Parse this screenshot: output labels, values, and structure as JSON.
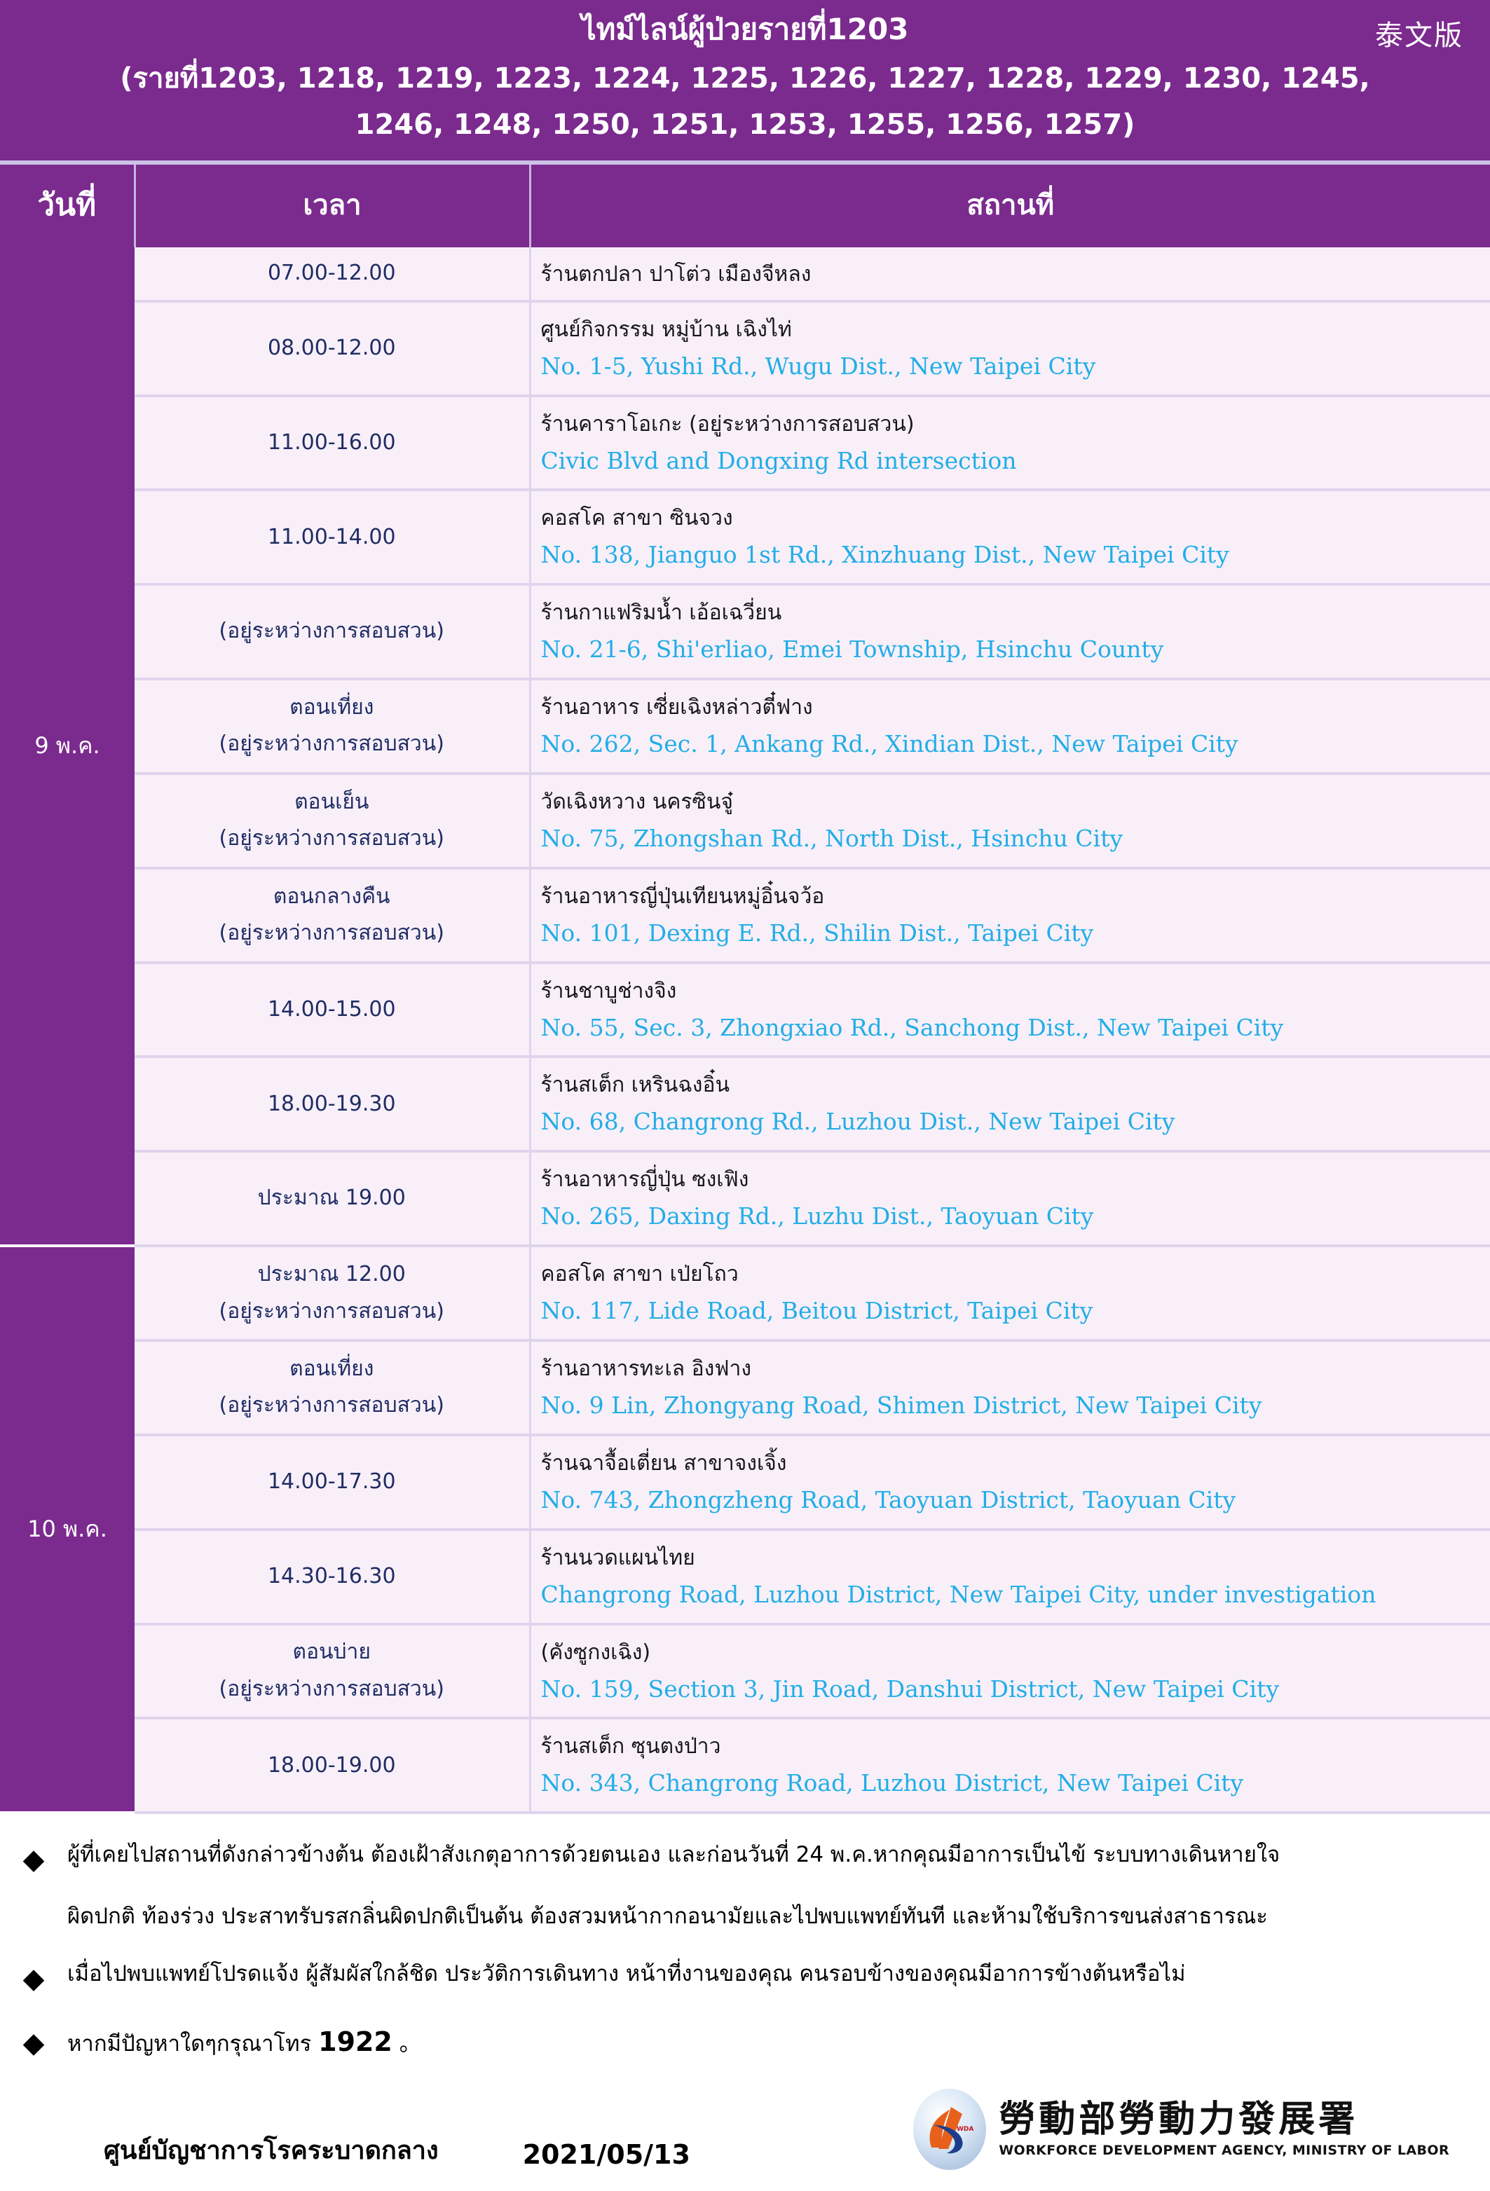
{
  "header": {
    "title": "ไทม์ไลน์ผู้ป่วยรายที่1203",
    "subtitle": "(รายที่1203, 1218, 1219, 1223, 1224, 1225, 1226, 1227, 1228, 1229, 1230, 1245, 1246, 1248, 1250, 1251, 1253, 1255, 1256, 1257)",
    "lang_badge": "泰文版",
    "bg_color": "#7B2A8E"
  },
  "table": {
    "columns": {
      "date": "วันที่",
      "time": "เวลา",
      "place": "สถานที่"
    },
    "groups": [
      {
        "date": "9 พ.ค.",
        "rows": [
          {
            "time": "07.00-12.00",
            "place_th": "ร้านตกปลา ปาโต่ว เมืองจีหลง",
            "place_en": ""
          },
          {
            "time": "08.00-12.00",
            "place_th": "ศูนย์กิจกรรม หมู่บ้าน เฉิงไท่",
            "place_en": "No. 1-5, Yushi Rd., Wugu Dist., New Taipei City"
          },
          {
            "time": "11.00-16.00",
            "place_th": "ร้านคาราโอเกะ (อยู่ระหว่างการสอบสวน)",
            "place_en": "Civic Blvd and Dongxing Rd intersection"
          },
          {
            "time": "11.00-14.00",
            "place_th": "คอสโค สาขา ซินจวง",
            "place_en": "No. 138, Jianguo 1st Rd., Xinzhuang Dist., New Taipei City"
          },
          {
            "time": "(อยู่ระหว่างการสอบสวน)",
            "place_th": "ร้านกาแฟริมน้ำ เอ้อเฉวี่ยน",
            "place_en": "No. 21-6, Shi'erliao, Emei Township, Hsinchu County"
          },
          {
            "time": "ตอนเที่ยง\n(อยู่ระหว่างการสอบสวน)",
            "place_th": "ร้านอาหาร เซี่ยเฉิงหล่าวตี๋ฟาง",
            "place_en": "No. 262, Sec. 1, Ankang Rd., Xindian Dist., New Taipei City"
          },
          {
            "time": "ตอนเย็น\n(อยู่ระหว่างการสอบสวน)",
            "place_th": "วัดเฉิงหวาง นครซินจู๋",
            "place_en": "No. 75, Zhongshan Rd., North Dist., Hsinchu City"
          },
          {
            "time": "ตอนกลางคืน\n(อยู่ระหว่างการสอบสวน)",
            "place_th": "ร้านอาหารญี่ปุ่นเทียนหมู่อิ๋นจว้อ",
            "place_en": "No. 101, Dexing E. Rd., Shilin Dist., Taipei City"
          },
          {
            "time": "14.00-15.00",
            "place_th": "ร้านชาบูช่างจิง",
            "place_en": "No. 55, Sec. 3, Zhongxiao Rd., Sanchong Dist., New Taipei City"
          },
          {
            "time": "18.00-19.30",
            "place_th": "ร้านสเต็ก เหรินฉงอิ๋น",
            "place_en": "No. 68, Changrong Rd., Luzhou Dist., New Taipei City"
          },
          {
            "time": "ประมาณ 19.00",
            "place_th": "ร้านอาหารญี่ปุ่น ซงเฟิง",
            "place_en": "No. 265, Daxing Rd., Luzhu Dist., Taoyuan City"
          }
        ]
      },
      {
        "date": "10 พ.ค.",
        "rows": [
          {
            "time": "ประมาณ 12.00\n(อยู่ระหว่างการสอบสวน)",
            "place_th": "คอสโค สาขา เป่ยโถว",
            "place_en": "No. 117, Lide Road, Beitou District, Taipei City"
          },
          {
            "time": "ตอนเที่ยง\n(อยู่ระหว่างการสอบสวน)",
            "place_th": "ร้านอาหารทะเล อิงฟาง",
            "place_en": "No. 9 Lin, Zhongyang Road, Shimen District, New Taipei City"
          },
          {
            "time": "14.00-17.30",
            "place_th": "ร้านฉาจื้อเตี่ยน สาขาจงเจิ้ง",
            "place_en": "No. 743, Zhongzheng Road, Taoyuan District, Taoyuan City"
          },
          {
            "time": "14.30-16.30",
            "place_th": "ร้านนวดแผนไทย",
            "place_en": "Changrong Road, Luzhou District, New Taipei City, under investigation"
          },
          {
            "time": "ตอนบ่าย\n(อยู่ระหว่างการสอบสวน)",
            "place_th": "(คังซูกงเฉิง)",
            "place_en": "No. 159, Section 3, Jin Road, Danshui District, New Taipei City"
          },
          {
            "time": "18.00-19.00",
            "place_th": "ร้านสเต็ก ซุนตงป่าว",
            "place_en": "No. 343, Changrong Road, Luzhou District, New Taipei City"
          }
        ]
      }
    ]
  },
  "notes": {
    "bullet_glyph": "◆",
    "items": [
      {
        "line1": "ผู้ที่เคยไปสถานที่ดังกล่าวข้างต้น ต้องเฝ้าสังเกตุอาการด้วยตนเอง และก่อนวันที่ 24 พ.ค.หากคุณมีอาการเป็นไข้ ระบบทางเดินหายใจ",
        "line2": "ผิดปกติ ท้องร่วง ประสาทรับรสกลิ่นผิดปกติเป็นต้น ต้องสวมหน้ากากอนามัยและไปพบแพทย์ทันที และห้ามใช้บริการขนส่งสาธารณะ"
      },
      {
        "line1": "เมื่อไปพบแพทย์โปรดแจ้ง ผู้สัมผัสใกล้ชิด ประวัติการเดินทาง หน้าที่งานของคุณ คนรอบข้างของคุณมีอาการข้างต้นหรือไม่",
        "line2": ""
      },
      {
        "line1": "หากมีปัญหาใดๆกรุณาโทร",
        "phone": "1922",
        "line1_tail": "。"
      }
    ]
  },
  "footer": {
    "org": "ศูนย์บัญชาการโรคระบาดกลาง",
    "date": "2021/05/13",
    "logo_cn": "勞動部勞動力發展署",
    "logo_en": "WORKFORCE  DEVELOPMENT AGENCY, MINISTRY OF LABOR"
  }
}
